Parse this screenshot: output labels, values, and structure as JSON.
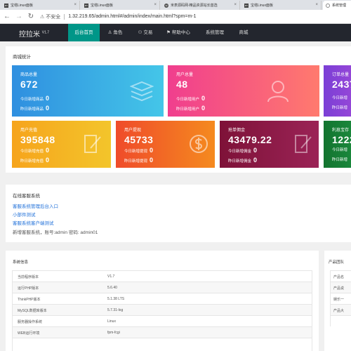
{
  "browser": {
    "tabs": [
      {
        "favicon": "BT",
        "title": "宝塔Linux面板"
      },
      {
        "favicon": "BT",
        "title": "宝塔Linux面板"
      },
      {
        "favicon": "W",
        "title": "米表源码网-精品资源站长首选"
      },
      {
        "favicon": "BT",
        "title": "宝塔Linux面板"
      },
      {
        "favicon": "",
        "title": "系统管理"
      }
    ],
    "security_label": "不安全",
    "url": "1.32.219.65/admin.html#/admin/index/main.html?spm=m-1"
  },
  "topnav": {
    "brand": "控拉米",
    "version": "V1.7",
    "items": [
      "后台首页",
      "角色",
      "交易",
      "帮助中心",
      "系统管理",
      "商城"
    ]
  },
  "stats": {
    "title": "商城统计",
    "cards": [
      {
        "label": "商品总量",
        "value": "672",
        "row1_label": "今日新增商品",
        "row1_value": "0",
        "row2_label": "昨日新增商品",
        "row2_value": "0",
        "icon": "layers-icon"
      },
      {
        "label": "用户总量",
        "value": "48",
        "row1_label": "今日新增用户",
        "row1_value": "0",
        "row2_label": "昨日新增用户",
        "row2_value": "0",
        "icon": "user-icon"
      },
      {
        "label": "订单总量",
        "value": "2437",
        "row1_label": "今日新增",
        "row1_value": "",
        "row2_label": "昨日新增",
        "row2_value": "",
        "icon": "order-icon"
      },
      {
        "label": "用户充值",
        "value": "395848",
        "row1_label": "今日新增充值",
        "row1_value": "0",
        "row2_label": "昨日新增充值",
        "row2_value": "0",
        "icon": "edit-icon"
      },
      {
        "label": "用户提现",
        "value": "45733",
        "row1_label": "今日新增提现",
        "row1_value": "0",
        "row2_label": "昨日新增提现",
        "row2_value": "0",
        "icon": "dollar-icon"
      },
      {
        "label": "抢单佣金",
        "value": "43479.22",
        "row1_label": "今日新增佣金",
        "row1_value": "0",
        "row2_label": "昨日新增佣金",
        "row2_value": "0",
        "icon": "edit-icon"
      },
      {
        "label": "利息宝存",
        "value": "1222",
        "row1_label": "今日新增",
        "row1_value": "",
        "row2_label": "昨日新增",
        "row2_value": "",
        "icon": "edit-icon"
      }
    ],
    "colors": [
      "#39a4e6",
      "#f0488a",
      "#8a3cd8",
      "#f4b417",
      "#ef5f22",
      "#8e1a4a",
      "#17823a"
    ]
  },
  "support": {
    "title": "在线客服系统",
    "links": [
      "客服系统管理后台入口",
      "小部件测试",
      "客服系统客户端测试"
    ],
    "info": "新增客服系统，账号:admin 密码: admin01"
  },
  "sysinfo": {
    "title": "系统信息",
    "rows": [
      [
        "当前程序版本",
        "V1.7"
      ],
      [
        "运行PHP版本",
        "5.6.40"
      ],
      [
        "ThinkPHP版本",
        "5.1.38 LTS"
      ],
      [
        "MySQL数据库版本",
        "5.7.31-log"
      ],
      [
        "服务器操作系统",
        "Linux"
      ],
      [
        "WEB运行环境",
        "fpm-fcgi"
      ]
    ]
  },
  "team": {
    "title": "产品团队",
    "rows": [
      "产品名",
      "产品说",
      "娱乐一",
      "产品大"
    ]
  }
}
